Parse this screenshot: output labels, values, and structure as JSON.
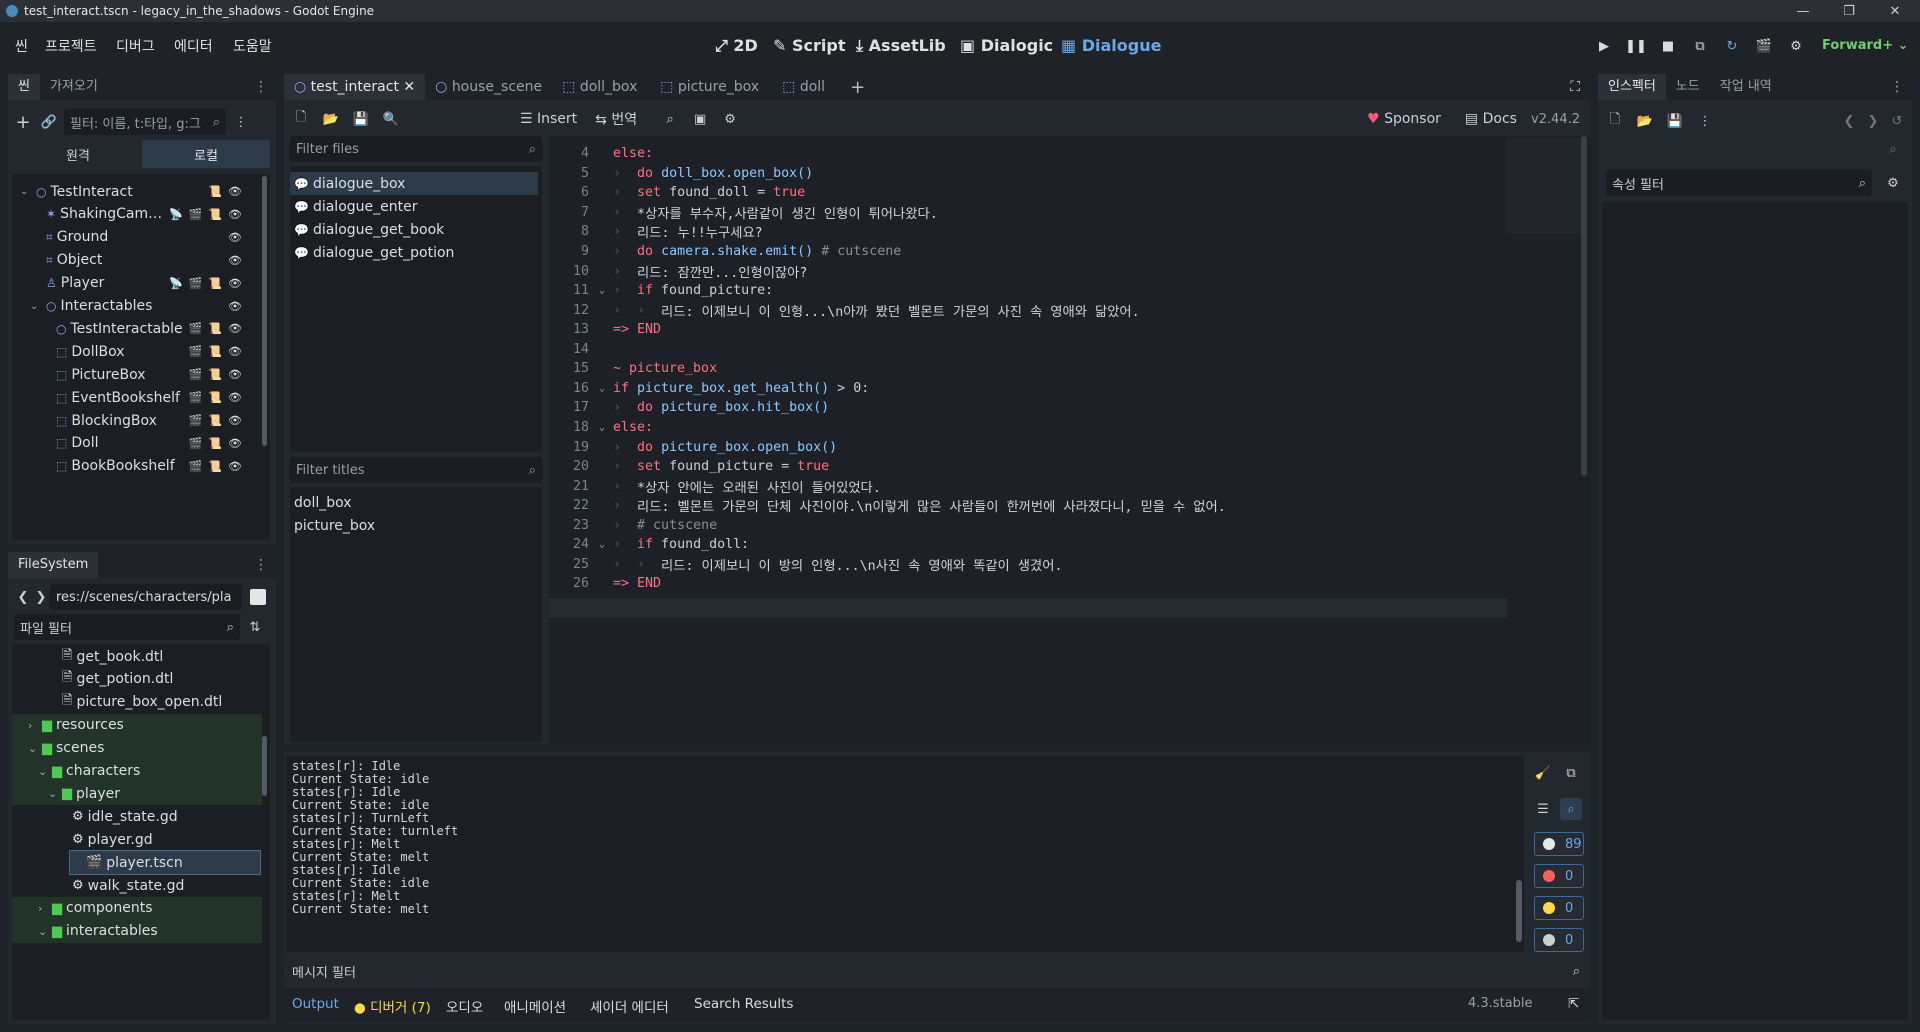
{
  "titlebar": {
    "title": "test_interact.tscn - legacy_in_the_shadows - Godot Engine"
  },
  "menu": [
    "씬",
    "프로젝트",
    "디버그",
    "에디터",
    "도움말"
  ],
  "main_screens": [
    {
      "icon": "2d-icon",
      "label": "2D",
      "glyph": "⤢"
    },
    {
      "icon": "script-icon",
      "label": "Script",
      "glyph": "✎"
    },
    {
      "icon": "assetlib-icon",
      "label": "AssetLib",
      "glyph": "⤓"
    },
    {
      "icon": "dialogic-icon",
      "label": "Dialogic",
      "glyph": "▣"
    },
    {
      "icon": "dialogue-icon",
      "label": "Dialogue",
      "glyph": "▦"
    }
  ],
  "renderer": "Forward+",
  "scene_dock": {
    "tabs": [
      "씬",
      "가져오기"
    ],
    "filter_placeholder": "필터: 이름, t:타입, g:그",
    "toggle": [
      "원격",
      "로컬"
    ],
    "tree": [
      {
        "name": "TestInteract",
        "icon": "node-icon"
      },
      {
        "name": "ShakingCam…",
        "icon": "camera-icon"
      },
      {
        "name": "Ground",
        "icon": "tilemap-icon"
      },
      {
        "name": "Object",
        "icon": "tilemap-icon"
      },
      {
        "name": "Player",
        "icon": "character-icon"
      },
      {
        "name": "Interactables",
        "icon": "node-icon"
      },
      {
        "name": "TestInteractable",
        "icon": "node-icon"
      },
      {
        "name": "DollBox",
        "icon": "scene-instance-icon"
      },
      {
        "name": "PictureBox",
        "icon": "scene-instance-icon"
      },
      {
        "name": "EventBookshelf",
        "icon": "scene-instance-icon"
      },
      {
        "name": "BlockingBox",
        "icon": "scene-instance-icon"
      },
      {
        "name": "Doll",
        "icon": "scene-instance-icon"
      },
      {
        "name": "BookBookshelf",
        "icon": "scene-instance-icon"
      }
    ]
  },
  "filesystem": {
    "tab": "FileSystem",
    "path": "res://scenes/characters/pla",
    "filter_placeholder": "파일 필터",
    "items": [
      {
        "name": "get_book.dtl",
        "type": "file"
      },
      {
        "name": "get_potion.dtl",
        "type": "file"
      },
      {
        "name": "picture_box_open.dtl",
        "type": "file"
      },
      {
        "name": "resources",
        "type": "folder"
      },
      {
        "name": "scenes",
        "type": "folder"
      },
      {
        "name": "characters",
        "type": "folder"
      },
      {
        "name": "player",
        "type": "folder"
      },
      {
        "name": "idle_state.gd",
        "type": "script"
      },
      {
        "name": "player.gd",
        "type": "script"
      },
      {
        "name": "player.tscn",
        "type": "scene"
      },
      {
        "name": "walk_state.gd",
        "type": "script"
      },
      {
        "name": "components",
        "type": "folder"
      },
      {
        "name": "interactables",
        "type": "folder"
      }
    ]
  },
  "editor_tabs": [
    "test_interact",
    "house_scene",
    "doll_box",
    "picture_box",
    "doll"
  ],
  "toolbar": {
    "insert": "Insert",
    "translate": "번역",
    "sponsor": "Sponsor",
    "docs": "Docs",
    "version": "v2.44.2"
  },
  "dialogue_files": {
    "filter_placeholder": "Filter files",
    "items": [
      "dialogue_box",
      "dialogue_enter",
      "dialogue_get_book",
      "dialogue_get_potion"
    ],
    "selected": "dialogue_box"
  },
  "dialogue_titles": {
    "filter_placeholder": "Filter titles",
    "items": [
      "doll_box",
      "picture_box"
    ]
  },
  "code": [
    {
      "n": "4",
      "t": "else:"
    },
    {
      "n": "5",
      "t": "do doll_box.open_box()"
    },
    {
      "n": "6",
      "t": "set found_doll = true"
    },
    {
      "n": "7",
      "t": "*상자를 부수자,사람같이 생긴 인형이 튀어나왔다."
    },
    {
      "n": "8",
      "t": "리드: 누!!누구세요?"
    },
    {
      "n": "9",
      "t": "do camera.shake.emit() # cutscene"
    },
    {
      "n": "10",
      "t": "리드: 잠깐만...인형이잖아?"
    },
    {
      "n": "11",
      "t": "if found_picture:"
    },
    {
      "n": "12",
      "t": "리드: 이제보니 이 인형...\\n아까 봤던 벨몬트 가문의 사진 속 영애와 닮았어."
    },
    {
      "n": "13",
      "t": "=> END"
    },
    {
      "n": "14",
      "t": ""
    },
    {
      "n": "15",
      "t": "~ picture_box"
    },
    {
      "n": "16",
      "t": "if picture_box.get_health() > 0:"
    },
    {
      "n": "17",
      "t": "do picture_box.hit_box()"
    },
    {
      "n": "18",
      "t": "else:"
    },
    {
      "n": "19",
      "t": "do picture_box.open_box()"
    },
    {
      "n": "20",
      "t": "set found_picture = true"
    },
    {
      "n": "21",
      "t": "*상자 안에는 오래된 사진이 들어있었다."
    },
    {
      "n": "22",
      "t": "리드: 벨몬트 가문의 단체 사진이야.\\n이렇게 많은 사람들이 한꺼번에 사라졌다니, 믿을 수 없어."
    },
    {
      "n": "23",
      "t": "# cutscene"
    },
    {
      "n": "24",
      "t": "if found_doll:"
    },
    {
      "n": "25",
      "t": "리드: 이제보니 이 방의 인형...\\n사진 속 영애와 똑같이 생겼어."
    },
    {
      "n": "26",
      "t": "=> END"
    }
  ],
  "output_log": [
    "states[r]: Idle",
    "Current State: idle",
    "states[r]: Idle",
    "Current State: idle",
    "states[r]: TurnLeft",
    "Current State: turnleft",
    "states[r]: Melt",
    "Current State: melt",
    "states[r]: Idle",
    "Current State: idle",
    "states[r]: Melt",
    "Current State: melt"
  ],
  "output_filter_placeholder": "메시지 필터",
  "counts": {
    "messages": "89",
    "errors": "0",
    "warnings": "0",
    "info": "0"
  },
  "bottom_tabs": [
    "Output",
    "디버거 (7)",
    "오디오",
    "애니메이션",
    "셰이더 에디터",
    "Search Results"
  ],
  "godot_version": "4.3.stable",
  "inspector": {
    "tabs": [
      "인스펙터",
      "노드",
      "작업 내역"
    ],
    "filter_placeholder": "속성 필터"
  },
  "colors": {
    "accent": "#6aa8e8",
    "keyword": "#ff7085",
    "function": "#8cc9ff",
    "folder": "#4fc94f",
    "error": "#ff5d5d",
    "warning": "#ffd84a"
  }
}
